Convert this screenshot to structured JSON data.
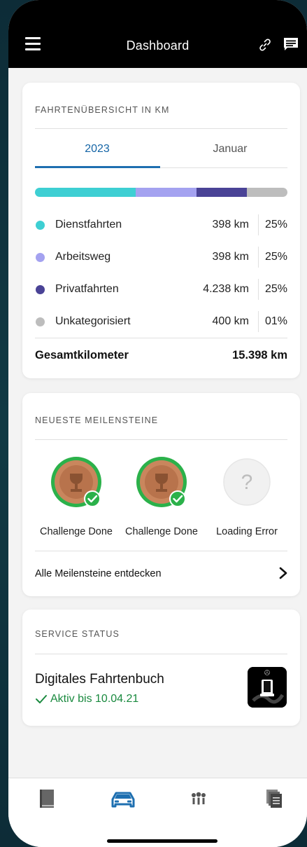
{
  "header": {
    "title": "Dashboard"
  },
  "trips": {
    "heading": "FAHRTENÜBERSICHT IN KM",
    "tabs": [
      {
        "label": "2023"
      },
      {
        "label": "Januar"
      }
    ],
    "active_tab": 0,
    "categories": [
      {
        "label": "Dienstfahrten",
        "km": "398 km",
        "pct": "25%",
        "color": "#3ecfd3"
      },
      {
        "label": "Arbeitsweg",
        "km": "398 km",
        "pct": "25%",
        "color": "#a4a2f0"
      },
      {
        "label": "Privatfahrten",
        "km": "4.238 km",
        "pct": "25%",
        "color": "#4a4396"
      },
      {
        "label": "Unkategorisiert",
        "km": "400 km",
        "pct": "01%",
        "color": "#bdbdbd"
      }
    ],
    "bar_fractions": [
      0.4,
      0.24,
      0.2,
      0.16
    ],
    "total_label": "Gesamtkilometer",
    "total_value": "15.398 km"
  },
  "milestones": {
    "heading": "NEUESTE MEILENSTEINE",
    "items": [
      {
        "label": "Challenge Done",
        "state": "done"
      },
      {
        "label": "Challenge Done",
        "state": "done"
      },
      {
        "label": "Loading Error",
        "state": "error"
      }
    ],
    "link": "Alle Meilensteine entdecken"
  },
  "service": {
    "heading": "SERVICE STATUS",
    "title": "Digitales Fahrtenbuch",
    "status": "Aktiv bis 10.04.21"
  },
  "colors": {
    "accent": "#1e6fb0",
    "success": "#1a8a3f",
    "medal_ring": "#2bb14a",
    "bronze": "#c9865d"
  },
  "nav": {
    "icons": [
      "book-icon",
      "car-icon",
      "people-icon",
      "documents-icon"
    ],
    "active": 1
  }
}
